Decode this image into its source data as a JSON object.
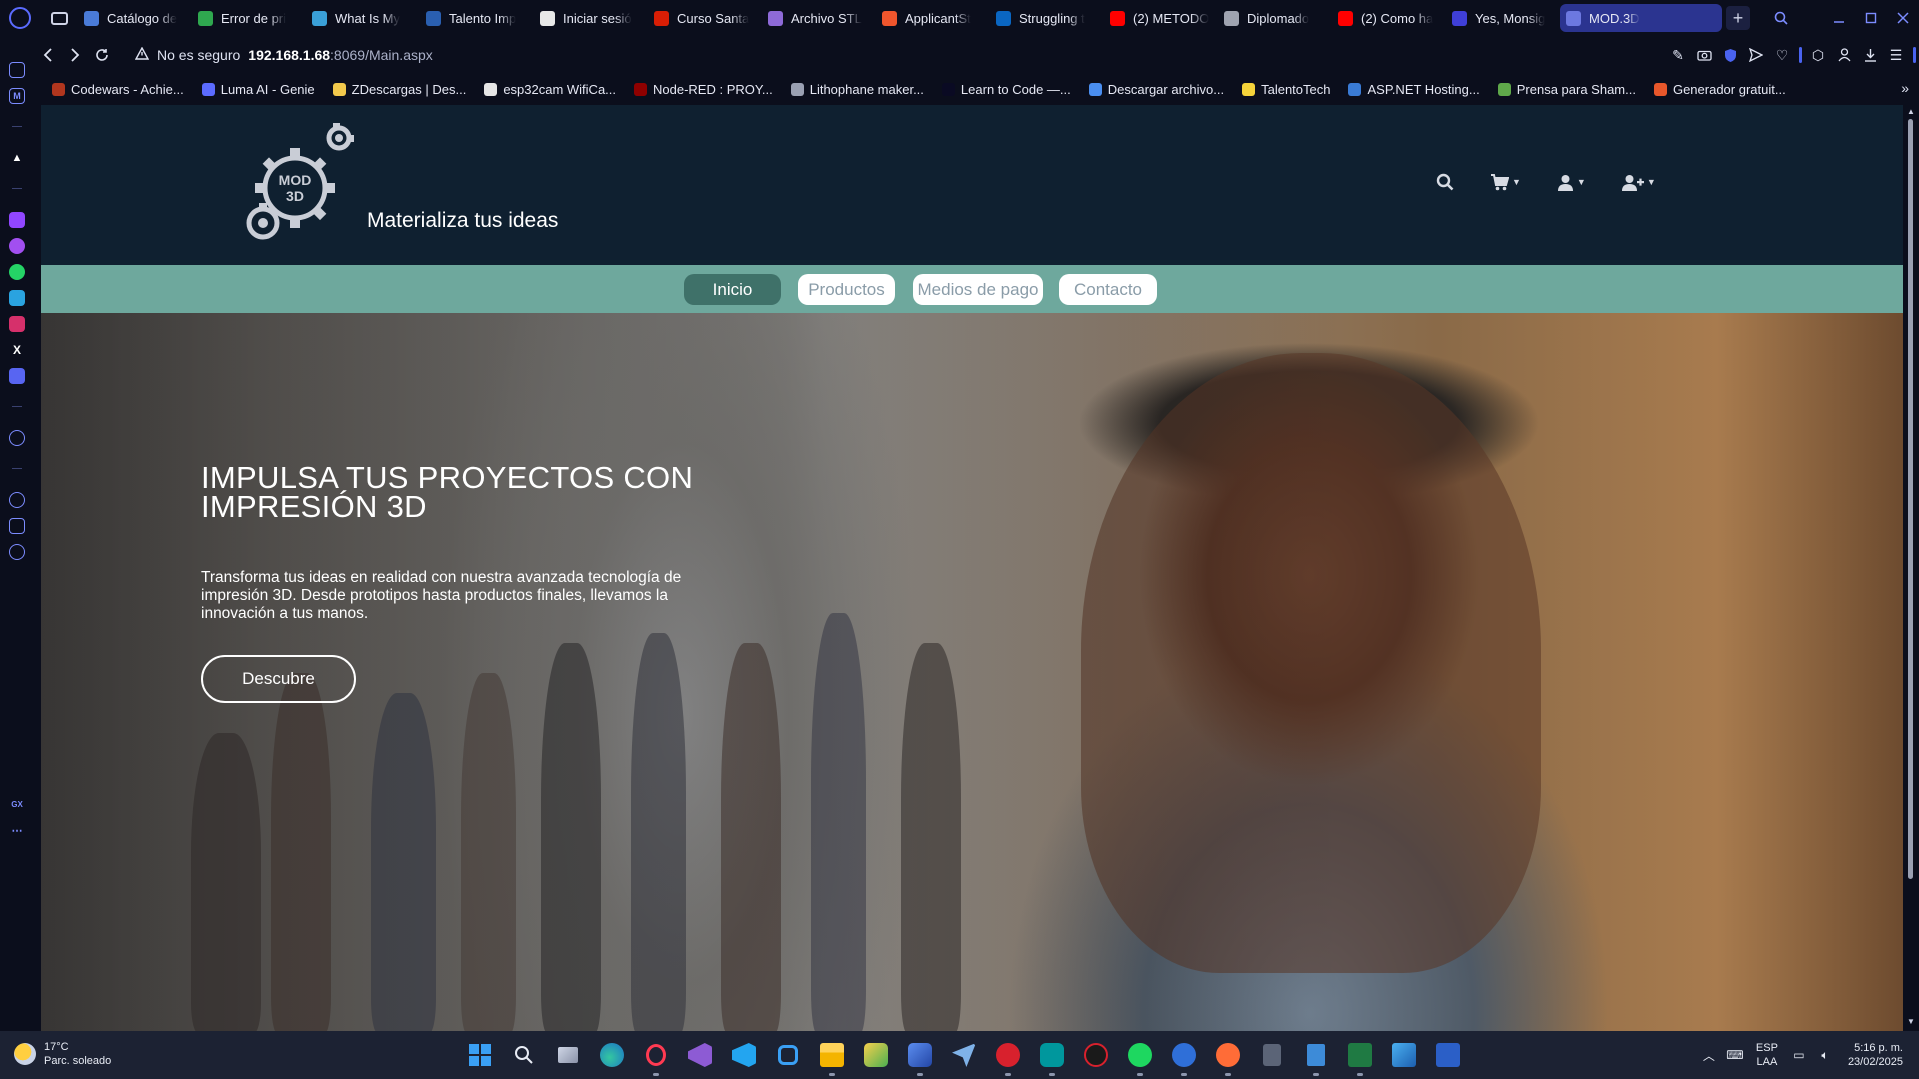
{
  "browser": {
    "tabs": [
      {
        "title": "Catálogo de",
        "icon": "catalog-favicon",
        "color": "#4a7bd8"
      },
      {
        "title": "Error de pri",
        "icon": "m-favicon",
        "color": "#2fa84f"
      },
      {
        "title": "What Is My",
        "icon": "globe-favicon",
        "color": "#3aa0d8"
      },
      {
        "title": "Talento Imp",
        "icon": "talento-favicon",
        "color": "#2a5fb0"
      },
      {
        "title": "Iniciar sesió",
        "icon": "page-favicon",
        "color": "#e8e8e8"
      },
      {
        "title": "Curso Santa",
        "icon": "santander-favicon",
        "color": "#d81e05"
      },
      {
        "title": "Archivo STL",
        "icon": "stl-favicon",
        "color": "#8e6ad8"
      },
      {
        "title": "ApplicantSt",
        "icon": "applicant-favicon",
        "color": "#f0562d"
      },
      {
        "title": "Struggling t",
        "icon": "linkedin-favicon",
        "color": "#0a66c2"
      },
      {
        "title": "(2) METODO",
        "icon": "youtube-favicon",
        "color": "#ff0000"
      },
      {
        "title": "Diplomado",
        "icon": "openai-favicon",
        "color": "#9fa3b0"
      },
      {
        "title": "(2) Como ha",
        "icon": "youtube-favicon",
        "color": "#ff0000"
      },
      {
        "title": "Yes, Monsig",
        "icon": "m-favicon",
        "color": "#3f3fd8"
      },
      {
        "title": "MOD.3D",
        "icon": "mod3d-favicon",
        "color": "#6c78e0",
        "active": true
      }
    ],
    "new_tab_label": "+",
    "address": {
      "warning": "No es seguro",
      "host": "192.168.1.68",
      "path": ":8069/Main.aspx"
    },
    "bookmarks": [
      {
        "label": "Codewars - Achie...",
        "color": "#b1361e"
      },
      {
        "label": "Luma AI - Genie",
        "color": "#5b6bff"
      },
      {
        "label": "ZDescargas | Des...",
        "color": "#f2c94c"
      },
      {
        "label": "esp32cam WifiCa...",
        "color": "#e6e6e6"
      },
      {
        "label": "Node-RED : PROY...",
        "color": "#8f0000"
      },
      {
        "label": "Lithophane maker...",
        "color": "#9aa0b2"
      },
      {
        "label": "Learn to Code —...",
        "color": "#0a0a23"
      },
      {
        "label": "Descargar archivo...",
        "color": "#4a8ef0"
      },
      {
        "label": "TalentoTech",
        "color": "#f5d33a"
      },
      {
        "label": "ASP.NET Hosting...",
        "color": "#3a7bd5"
      },
      {
        "label": "Prensa para Sham...",
        "color": "#5fa84a"
      },
      {
        "label": "Generador gratuit...",
        "color": "#e8572b"
      }
    ]
  },
  "site": {
    "logo_text_top": "MOD",
    "logo_text_bottom": "3D",
    "tagline": "Materializa tus ideas",
    "nav": [
      {
        "label": "Inicio",
        "active": true
      },
      {
        "label": "Productos",
        "active": false
      },
      {
        "label": "Medios de pago",
        "active": false
      },
      {
        "label": "Contacto",
        "active": false
      }
    ],
    "hero": {
      "title": "IMPULSA TUS PROYECTOS CON IMPRESIÓN 3D",
      "text": "Transforma tus ideas en realidad con nuestra avanzada tecnología de impresión 3D. Desde prototipos hasta productos finales, llevamos la innovación a tus manos.",
      "button": "Descubre"
    },
    "colors": {
      "header_bg": "#0f2030",
      "nav_bg": "#6ea89d",
      "nav_active": "#3f7169"
    }
  },
  "taskbar": {
    "weather_temp": "17°C",
    "weather_desc": "Parc. soleado",
    "lang_top": "ESP",
    "lang_bottom": "LAA",
    "time": "5:16 p. m.",
    "date": "23/02/2025"
  }
}
